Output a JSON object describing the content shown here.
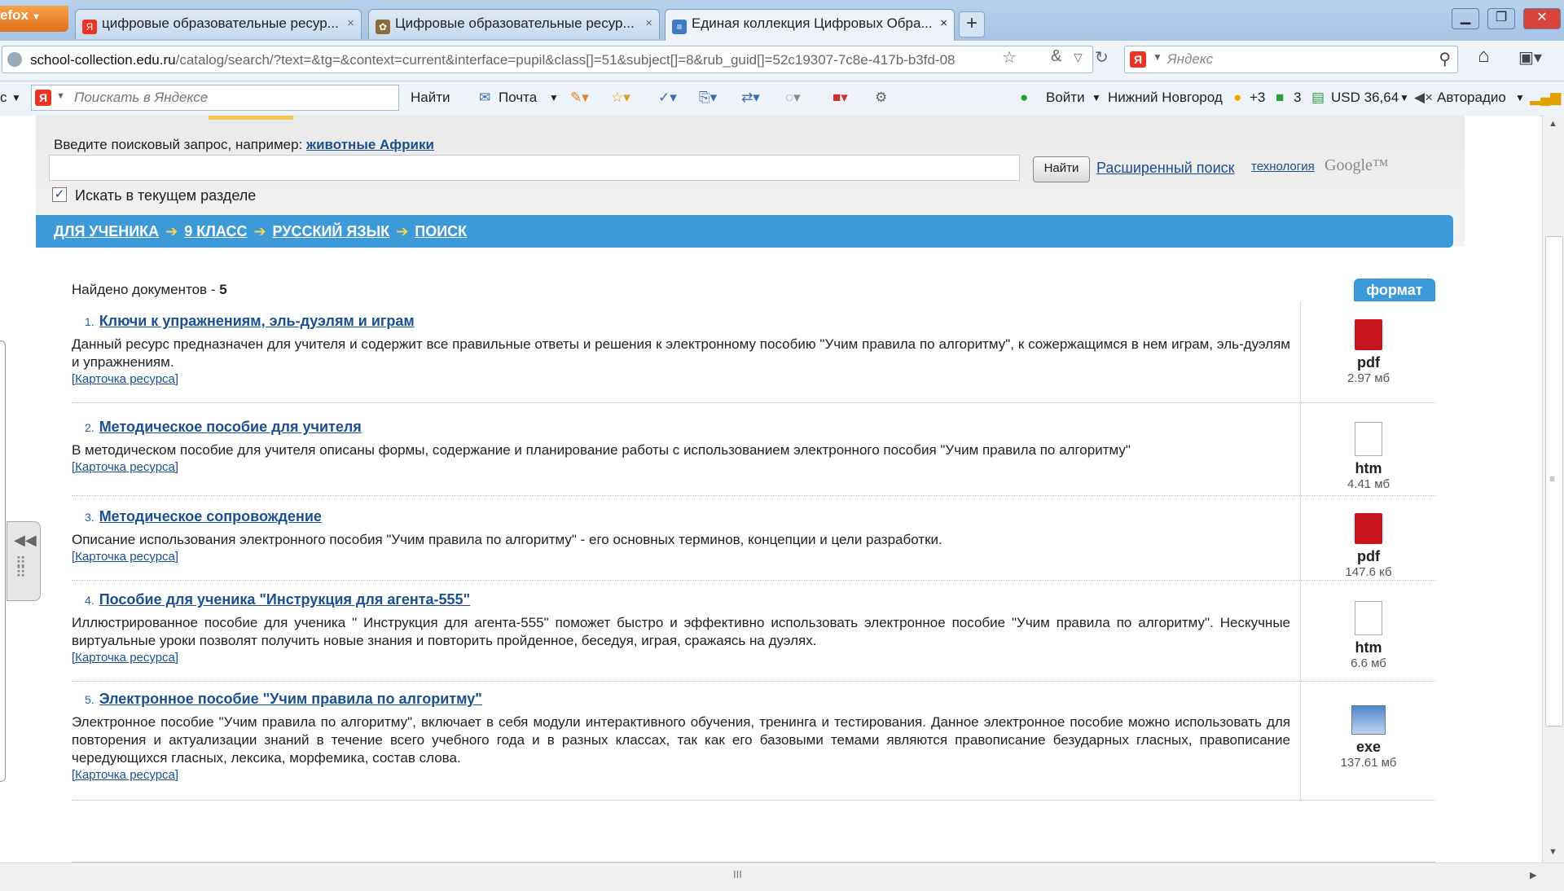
{
  "browser": {
    "app_button": "efox",
    "tabs": [
      {
        "label": "цифровые образовательные ресур...",
        "active": false
      },
      {
        "label": "Цифровые образовательные ресур...",
        "active": false
      },
      {
        "label": "Единая коллекция Цифровых Обра...",
        "active": true
      }
    ],
    "new_tab": "+",
    "url_domain": "school-collection.edu.ru",
    "url_path": "/catalog/search/?text=&tg=&context=current&interface=pupil&class[]=51&subject[]=8&rub_guid[]=52c19307-7c8e-417b-b3fd-08",
    "search_placeholder": "Яндекс"
  },
  "yandex_toolbar": {
    "left_label": "c",
    "search_placeholder": "Поискать в Яндексе",
    "find": "Найти",
    "mail": "Почта",
    "login": "Войти",
    "city": "Нижний Новгород",
    "weather": "+3",
    "traffic": "3",
    "currency": "USD 36,64",
    "radio": "Авторадио"
  },
  "search_panel": {
    "hint": "Введите поисковый запрос, например:",
    "hint_link": "животные Африки",
    "query_value": "",
    "find_button": "Найти",
    "advanced_link": "Расширенный поиск",
    "tech_link": "технология",
    "google": "Google™",
    "in_section_label": "Искать в текущем разделе",
    "in_section_checked": true
  },
  "breadcrumb": [
    "ДЛЯ УЧЕНИКА",
    "9 КЛАСС",
    "РУССКИЙ ЯЗЫК",
    "ПОИСК"
  ],
  "breadcrumb_sep": "➔",
  "results": {
    "found_label": "Найдено документов -",
    "found_count": "5",
    "format_header": "формат",
    "card_label": "[Карточка ресурса]",
    "items": [
      {
        "num": "1.",
        "title": "Ключи к упражнениям, эль-дуэлям и играм",
        "desc": "Данный ресурс предназначен для учителя и содержит все правильные ответы и решения к электронному пособию \"Учим правила по алгоритму\", к сожержащимся в нем играм, эль-дуэлям и упражнениям.",
        "ext": "pdf",
        "size": "2.97 мб",
        "icon": "pdf-icon"
      },
      {
        "num": "2.",
        "title": "Методическое пособие для учителя",
        "desc": "В методическом пособие для учителя описаны формы, содержание и планирование работы с использованием электронного пособия \"Учим правила по алгоритму\"",
        "ext": "htm",
        "size": "4.41 мб",
        "icon": "htm-icon"
      },
      {
        "num": "3.",
        "title": "Методическое сопровождение",
        "desc": "Описание использования электронного пособия \"Учим правила по алгоритму\" - его основных терминов, концепции и цели разработки.",
        "ext": "pdf",
        "size": "147.6 кб",
        "icon": "pdf-icon"
      },
      {
        "num": "4.",
        "title": "Пособие для ученика \"Инструкция для агента-555\"",
        "desc": "Иллюстрированное пособие для ученика \" Инструкция для агента-555\" поможет быстро и эффективно использовать электронное пособие \"Учим правила по алгоритму\". Нескучные виртуальные уроки позволят получить новые знания и повторить пройденное, беседуя, играя, сражаясь на дуэлях.",
        "ext": "htm",
        "size": "6.6 мб",
        "icon": "htm-icon"
      },
      {
        "num": "5.",
        "title": "Электронное пособие \"Учим правила по алгоритму\"",
        "desc": "Электронное пособие \"Учим правила по алгоритму\", включает в себя модули интерактивного обучения, тренинга и тестирования. Данное электронное пособие можно использовать для повторения и актуализации знаний в течение всего учебного года и в разных классах, так как его базовыми темами являются правописание безударных гласных, правописание чередующихся гласных, лексика, морфемика, состав слова.",
        "ext": "exe",
        "size": "137.61 мб",
        "icon": "exe-icon"
      }
    ]
  },
  "hscroll_grip": "III"
}
